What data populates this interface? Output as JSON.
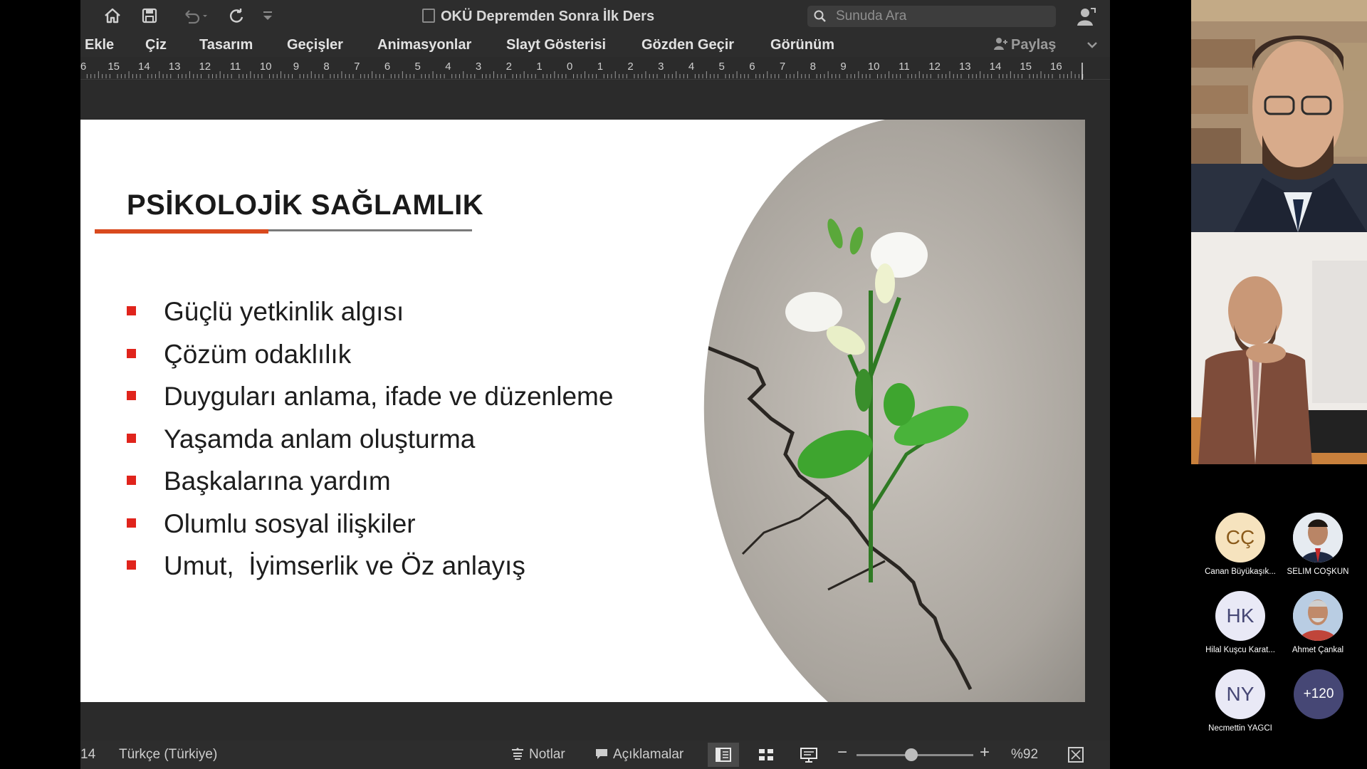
{
  "app": {
    "title": "OKÜ Depremden Sonra İlk Ders",
    "search_placeholder": "Sunuda Ara",
    "menu": [
      "Ekle",
      "Çiz",
      "Tasarım",
      "Geçişler",
      "Animasyonlar",
      "Slayt Gösterisi",
      "Gözden Geçir",
      "Görünüm"
    ],
    "share_label": "Paylaş",
    "ruler_labels": [
      "6",
      "15",
      "14",
      "13",
      "12",
      "11",
      "10",
      "9",
      "8",
      "7",
      "6",
      "5",
      "4",
      "3",
      "2",
      "1",
      "0",
      "1",
      "2",
      "3",
      "4",
      "5",
      "6",
      "7",
      "8",
      "9",
      "10",
      "11",
      "12",
      "13",
      "14",
      "15",
      "16"
    ]
  },
  "slide": {
    "title": "PSİKOLOJİK SAĞLAMLIK",
    "bullets": [
      "Güçlü yetkinlik algısı",
      "Çözüm odaklılık",
      "Duyguları anlama, ifade ve düzenleme",
      "Yaşamda anlam oluşturma",
      "Başkalarına yardım",
      "Olumlu sosyal ilişkiler",
      "Umut,  İyimserlik ve Öz anlayış"
    ],
    "accent_color": "#d94a1e",
    "bullet_color": "#e0241c"
  },
  "statusbar": {
    "slide_num": "14",
    "language": "Türkçe (Türkiye)",
    "notes_label": "Notlar",
    "comments_label": "Açıklamalar",
    "zoom_minus": "−",
    "zoom_plus": "+",
    "zoom_level": "%92"
  },
  "participants": [
    {
      "initials": "CÇ",
      "name": "Canan Büyükaşık...",
      "bg": "#f6e3be",
      "fg": "#8a5a1a"
    },
    {
      "initials": "",
      "name": "SELİM COŞKUN",
      "bg": "#dfe6ee",
      "fg": "#333"
    },
    {
      "initials": "HK",
      "name": "Hilal Kuşcu Karat...",
      "bg": "#e9e9f6",
      "fg": "#464775"
    },
    {
      "initials": "",
      "name": "Ahmet Çankal",
      "bg": "#c9d7e8",
      "fg": "#333"
    },
    {
      "initials": "NY",
      "name": "Necmettin YAĞCI",
      "bg": "#e9e9f6",
      "fg": "#464775"
    }
  ],
  "more_count": "+120"
}
